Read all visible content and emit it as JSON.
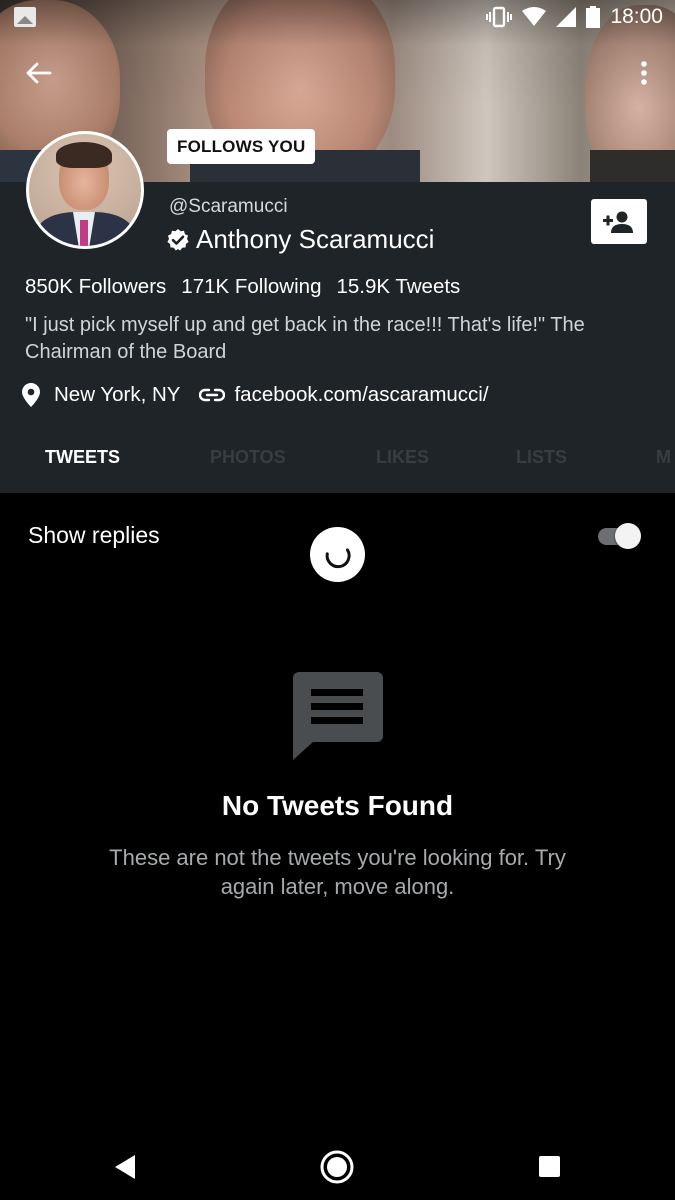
{
  "status_bar": {
    "time": "18:00"
  },
  "header": {
    "follows_badge": "FOLLOWS YOU",
    "icons": {
      "back": "arrow-left-icon",
      "more": "more-vert-icon"
    }
  },
  "profile": {
    "handle": "@Scaramucci",
    "name": "Anthony Scaramucci",
    "verified": true,
    "stats": {
      "followers": "850K Followers",
      "following": "171K Following",
      "tweets": "15.9K Tweets"
    },
    "bio": "\"I just pick myself up and get back in the race!!! That's life!\" The Chairman of the Board",
    "location": "New York, NY",
    "website": "facebook.com/ascaramucci/"
  },
  "tabs": [
    {
      "label": "TWEETS",
      "active": true
    },
    {
      "label": "PHOTOS",
      "active": false
    },
    {
      "label": "LIKES",
      "active": false
    },
    {
      "label": "LISTS",
      "active": false
    },
    {
      "label": "M",
      "active": false
    }
  ],
  "content": {
    "show_replies_label": "Show replies",
    "show_replies_enabled": true,
    "empty_title": "No Tweets Found",
    "empty_subtitle": "These are not the tweets you're looking for. Try again later, move along."
  },
  "colors": {
    "profile_panel": "#1e2427",
    "background": "#000000",
    "inactive_tab": "#373d41"
  }
}
